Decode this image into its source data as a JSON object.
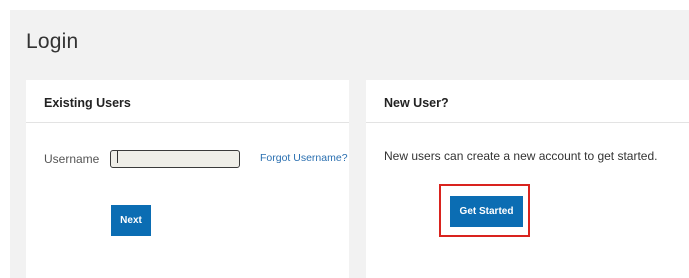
{
  "page": {
    "title": "Login"
  },
  "existing_users": {
    "header": "Existing Users",
    "username_label": "Username",
    "username_value": "",
    "forgot_username_link": "Forgot Username?",
    "next_button": "Next"
  },
  "new_user": {
    "header": "New User?",
    "description": "New users can create a new account to get started.",
    "get_started_button": "Get Started"
  },
  "colors": {
    "primary_button": "#0b6db3",
    "link": "#2a6fb0",
    "highlight_border": "#d9231e",
    "background": "#f2f2f2"
  }
}
